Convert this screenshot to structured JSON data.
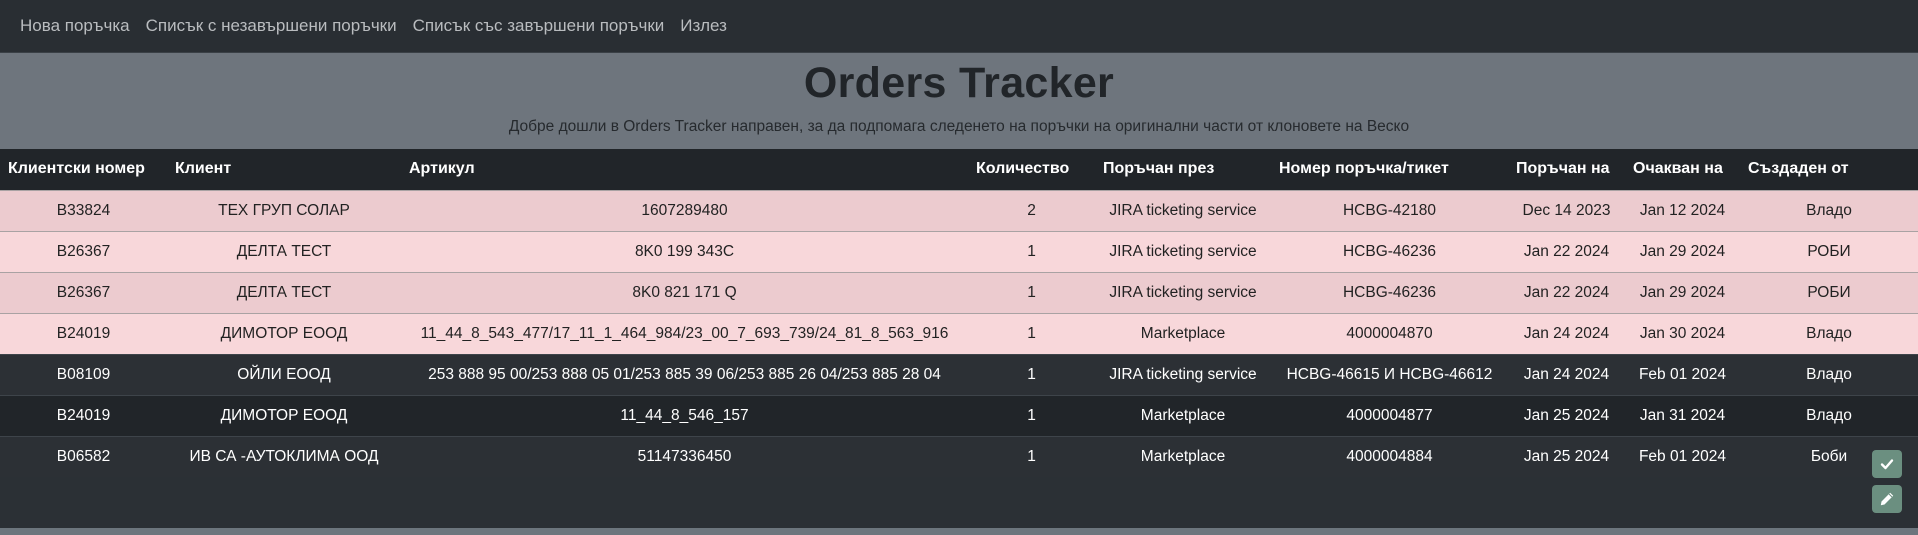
{
  "nav": {
    "items": [
      {
        "label": "Нова поръчка"
      },
      {
        "label": "Списък с незавършени поръчки"
      },
      {
        "label": "Списък със завършени поръчки"
      },
      {
        "label": "Излез"
      }
    ]
  },
  "header": {
    "title": "Orders Tracker",
    "subtitle": "Добре дошли в Orders Tracker направен, за да подпомага следенето на поръчки на оригинални части от клоновете на Веско"
  },
  "table": {
    "columns": [
      "Клиентски номер",
      "Клиент",
      "Артикул",
      "Количество",
      "Поръчан през",
      "Номер поръчка/тикет",
      "Поръчан на",
      "Очакван на",
      "Създаден от"
    ],
    "rows": [
      {
        "client_no": "B33824",
        "client": "ТЕХ ГРУП СОЛАР",
        "article": "1607289480",
        "qty": "2",
        "via": "JIRA ticketing service",
        "order_no": "HCBG-42180",
        "ordered": "Dec 14 2023",
        "expected": "Jan 12 2024",
        "created_by": "Владо"
      },
      {
        "client_no": "B26367",
        "client": "ДЕЛТА ТЕСТ",
        "article": "8K0 199 343C",
        "qty": "1",
        "via": "JIRA ticketing service",
        "order_no": "HCBG-46236",
        "ordered": "Jan 22 2024",
        "expected": "Jan 29 2024",
        "created_by": "РОБИ"
      },
      {
        "client_no": "B26367",
        "client": "ДЕЛТА ТЕСТ",
        "article": "8K0 821 171 Q",
        "qty": "1",
        "via": "JIRA ticketing service",
        "order_no": "HCBG-46236",
        "ordered": "Jan 22 2024",
        "expected": "Jan 29 2024",
        "created_by": "РОБИ"
      },
      {
        "client_no": "B24019",
        "client": "ДИМОТОР ЕООД",
        "article": "11_44_8_543_477/17_11_1_464_984/23_00_7_693_739/24_81_8_563_916",
        "qty": "1",
        "via": "Marketplace",
        "order_no": "4000004870",
        "ordered": "Jan 24 2024",
        "expected": "Jan 30 2024",
        "created_by": "Владо"
      },
      {
        "client_no": "B08109",
        "client": "ОЙЛИ ЕООД",
        "article": "253 888 95 00/253 888 05 01/253 885 39 06/253 885 26 04/253 885 28 04",
        "qty": "1",
        "via": "JIRA ticketing service",
        "order_no": "HCBG-46615 И HCBG-46612",
        "ordered": "Jan 24 2024",
        "expected": "Feb 01 2024",
        "created_by": "Владо"
      },
      {
        "client_no": "B24019",
        "client": "ДИМОТОР ЕООД",
        "article": "11_44_8_546_157",
        "qty": "1",
        "via": "Marketplace",
        "order_no": "4000004877",
        "ordered": "Jan 25 2024",
        "expected": "Jan 31 2024",
        "created_by": "Владо"
      },
      {
        "client_no": "B06582",
        "client": "ИВ СА -АУТОКЛИМА ООД",
        "article": "51147336450",
        "qty": "1",
        "via": "Marketplace",
        "order_no": "4000004884",
        "ordered": "Jan 25 2024",
        "expected": "Feb 01 2024",
        "created_by": "Боби"
      }
    ]
  },
  "actions": {
    "complete_icon": "check-icon",
    "edit_icon": "pencil-icon"
  },
  "colors": {
    "navbar": "#292e33",
    "header_band": "#6e757d",
    "table_head": "#212529",
    "row_pink_a": "#eccbcf",
    "row_pink_b": "#f8d7da",
    "row_dark_a": "#2c3035",
    "row_dark_b": "#212529",
    "action_button": "#6b8f80"
  }
}
